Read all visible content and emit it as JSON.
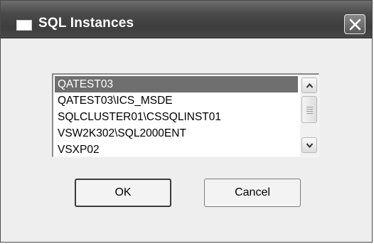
{
  "window": {
    "title": "SQL Instances",
    "close_icon": "close-icon",
    "app_icon": "window-icon"
  },
  "instance_list": {
    "selected_index": 0,
    "items": [
      "QATEST03",
      "QATEST03\\ICS_MSDE",
      "SQLCLUSTER01\\CSSQLINST01",
      "VSW2K302\\SQL2000ENT",
      "VSXP02"
    ],
    "scrollbar": {
      "up_icon": "chevron-up-icon",
      "down_icon": "chevron-down-icon"
    }
  },
  "buttons": {
    "ok_label": "OK",
    "cancel_label": "Cancel"
  },
  "colors": {
    "selection": "#6f6f6f",
    "titlebar": "#474747"
  }
}
